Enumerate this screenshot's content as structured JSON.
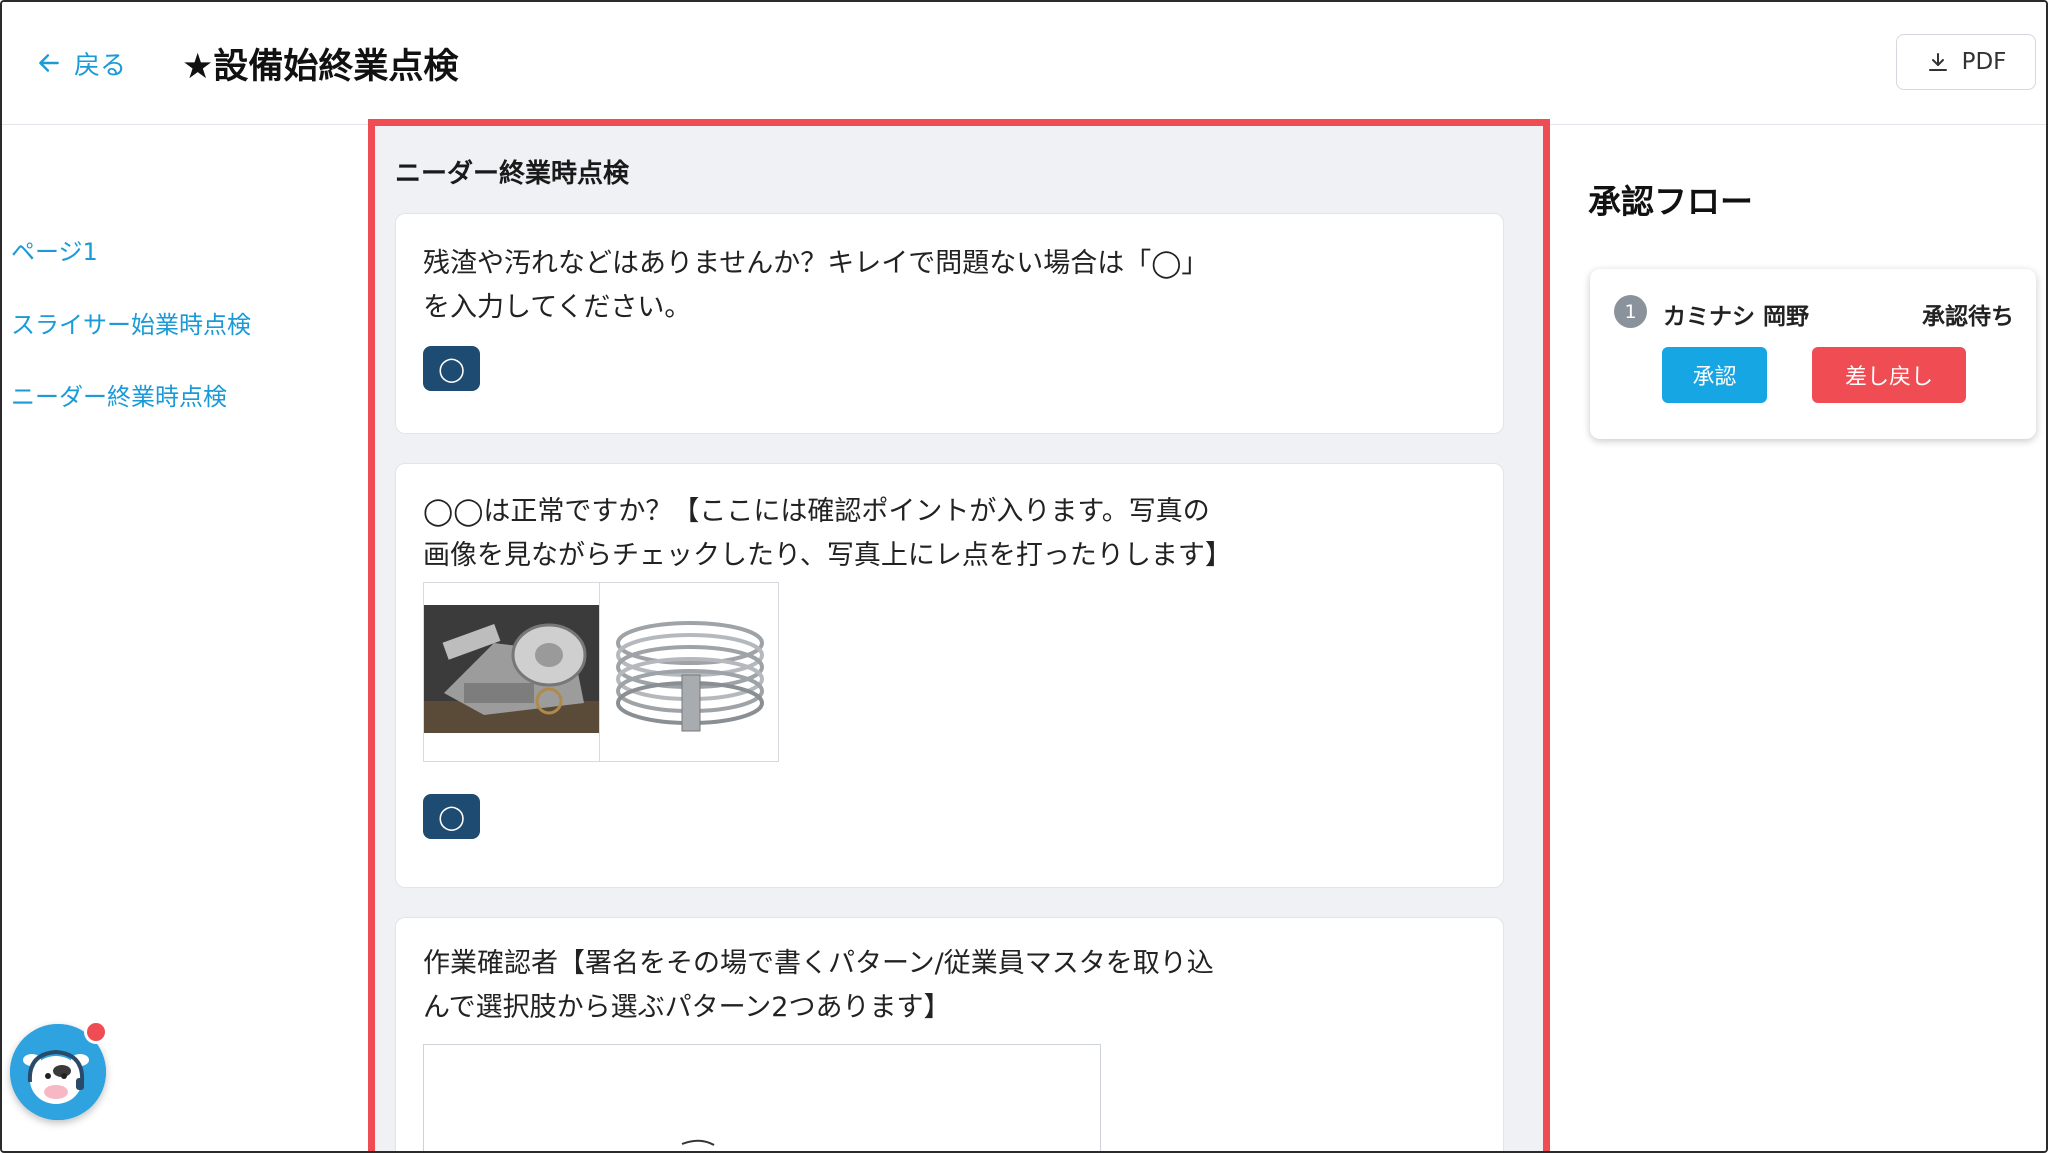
{
  "header": {
    "back_label": "戻る",
    "title": "★設備始終業点検",
    "pdf_label": "PDF"
  },
  "sidebar": {
    "items": [
      {
        "label": "ページ1"
      },
      {
        "label": "スライサー始業時点検"
      },
      {
        "label": "ニーダー終業時点検"
      }
    ]
  },
  "main": {
    "section_title": "ニーダー終業時点検",
    "questions": [
      {
        "text_line1": "残渣や汚れなどはありませんか？キレイで問題ない場合は「◯」",
        "text_line2": "を入力してください。",
        "answer": "◯"
      },
      {
        "text_line1": "◯◯は正常ですか？【ここには確認ポイントが入ります。写真の",
        "text_line2": "画像を見ながらチェックしたり、写真上にレ点を打ったりします】",
        "answer": "◯"
      },
      {
        "text_line1": "作業確認者【署名をその場で書くパターン/従業員マスタを取り込",
        "text_line2": "んで選択肢から選ぶパターン2つあります】"
      }
    ]
  },
  "approval": {
    "title": "承認フロー",
    "step_number": "1",
    "approver_name": "カミナシ 岡野",
    "status": "承認待ち",
    "approve_label": "承認",
    "reject_label": "差し戻し"
  },
  "colors": {
    "accent": "#1a9ad6",
    "chip": "#1e4b72",
    "danger": "#f04c54",
    "approve": "#16a6e3"
  }
}
